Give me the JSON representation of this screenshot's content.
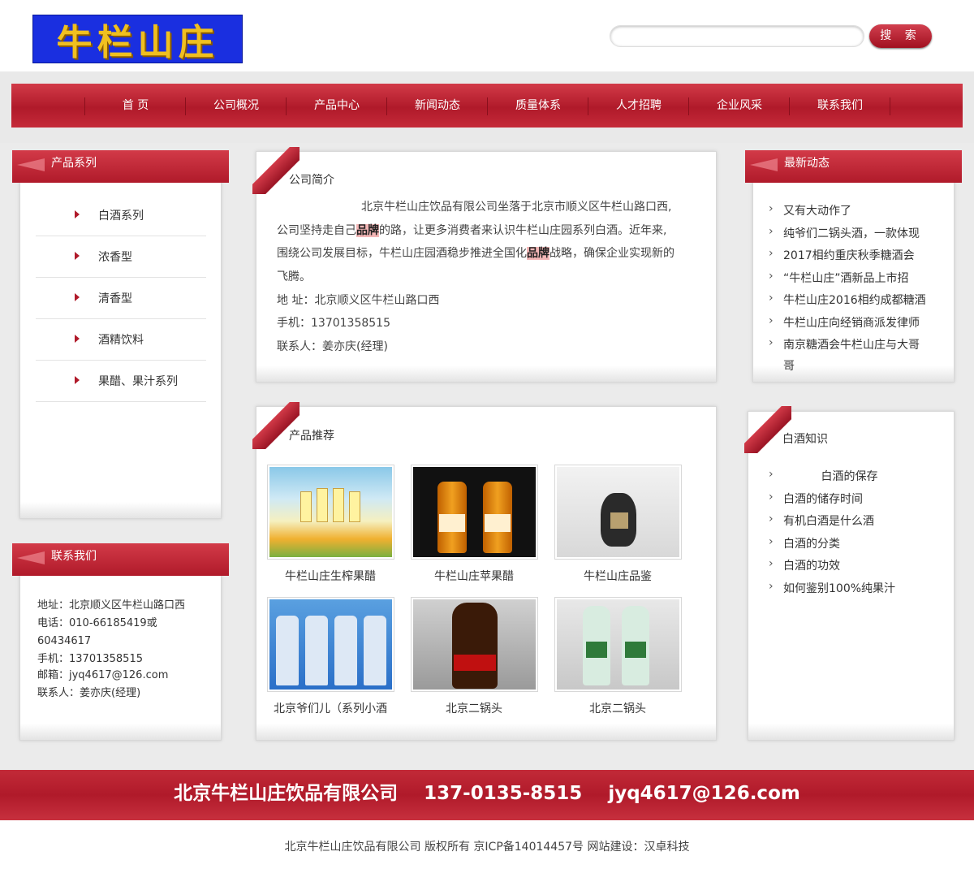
{
  "header": {
    "logo_text": "牛栏山庄",
    "search_placeholder": "",
    "search_button": "搜 索"
  },
  "nav": [
    "首 页",
    "公司概况",
    "产品中心",
    "新闻动态",
    "质量体系",
    "人才招聘",
    "企业风采",
    "联系我们"
  ],
  "product_series": {
    "title": "产品系列",
    "items": [
      "白酒系列",
      "浓香型",
      "清香型",
      "酒精饮料",
      "果醋、果汁系列"
    ]
  },
  "contact_box": {
    "title": "联系我们",
    "lines": [
      "地址：北京顺义区牛栏山路口西",
      "电话：010-66185419或",
      "60434617",
      "手机：13701358515",
      "邮箱：jyq4617@126.com",
      "联系人：姜亦庆(经理)"
    ]
  },
  "company_intro": {
    "title": "公司简介",
    "line1": "北京牛栏山庄饮品有限公司坐落于北京市顺义区牛栏山路口西,",
    "line2_a": "公司坚持走自己",
    "line2_hl": "品牌",
    "line2_b": "的路，让更多消费者来认识牛栏山庄园系列白酒。近年来,",
    "line3_a": "围绕公司发展目标，牛栏山庄园酒稳步推进全国化",
    "line3_hl": "品牌",
    "line3_b": "战略，确保企业实现新的",
    "line4": "飞腾。",
    "address": "地 址：北京顺义区牛栏山路口西",
    "mobile": "手机：13701358515",
    "contact": "联系人：姜亦庆(经理)"
  },
  "products": {
    "title": "产品推荐",
    "items": [
      {
        "name": "牛栏山庄生榨果醋"
      },
      {
        "name": "牛栏山庄苹果醋"
      },
      {
        "name": "牛栏山庄品鉴"
      },
      {
        "name": "北京爷们儿（系列小酒"
      },
      {
        "name": "北京二锅头"
      },
      {
        "name": "北京二锅头"
      }
    ]
  },
  "news": {
    "title": "最新动态",
    "items": [
      "又有大动作了",
      "纯爷们二锅头酒，一款体现",
      "2017相约重庆秋季糖酒会",
      "“牛栏山庄”酒新品上市招",
      "牛栏山庄2016相约成都糖酒",
      "牛栏山庄向经销商派发律师",
      "南京糖酒会牛栏山庄与大哥",
      "哥"
    ]
  },
  "knowledge": {
    "title": "白酒知识",
    "items": [
      "　　　 白酒的保存",
      "白酒的储存时间",
      "有机白酒是什么酒",
      "白酒的分类",
      "白酒的功效",
      "如何鉴别100%纯果汁"
    ]
  },
  "footer": {
    "main": "北京牛栏山庄饮品有限公司    137-0135-8515    jyq4617@126.com",
    "copyright": "北京牛栏山庄饮品有限公司  版权所有  京ICP备14014457号  网站建设：汉卓科技"
  },
  "colors": {
    "brand_red": "#b01a2a",
    "logo_blue": "#1a2fe0",
    "logo_gold": "#f0c020",
    "page_gray": "#ebebeb"
  }
}
